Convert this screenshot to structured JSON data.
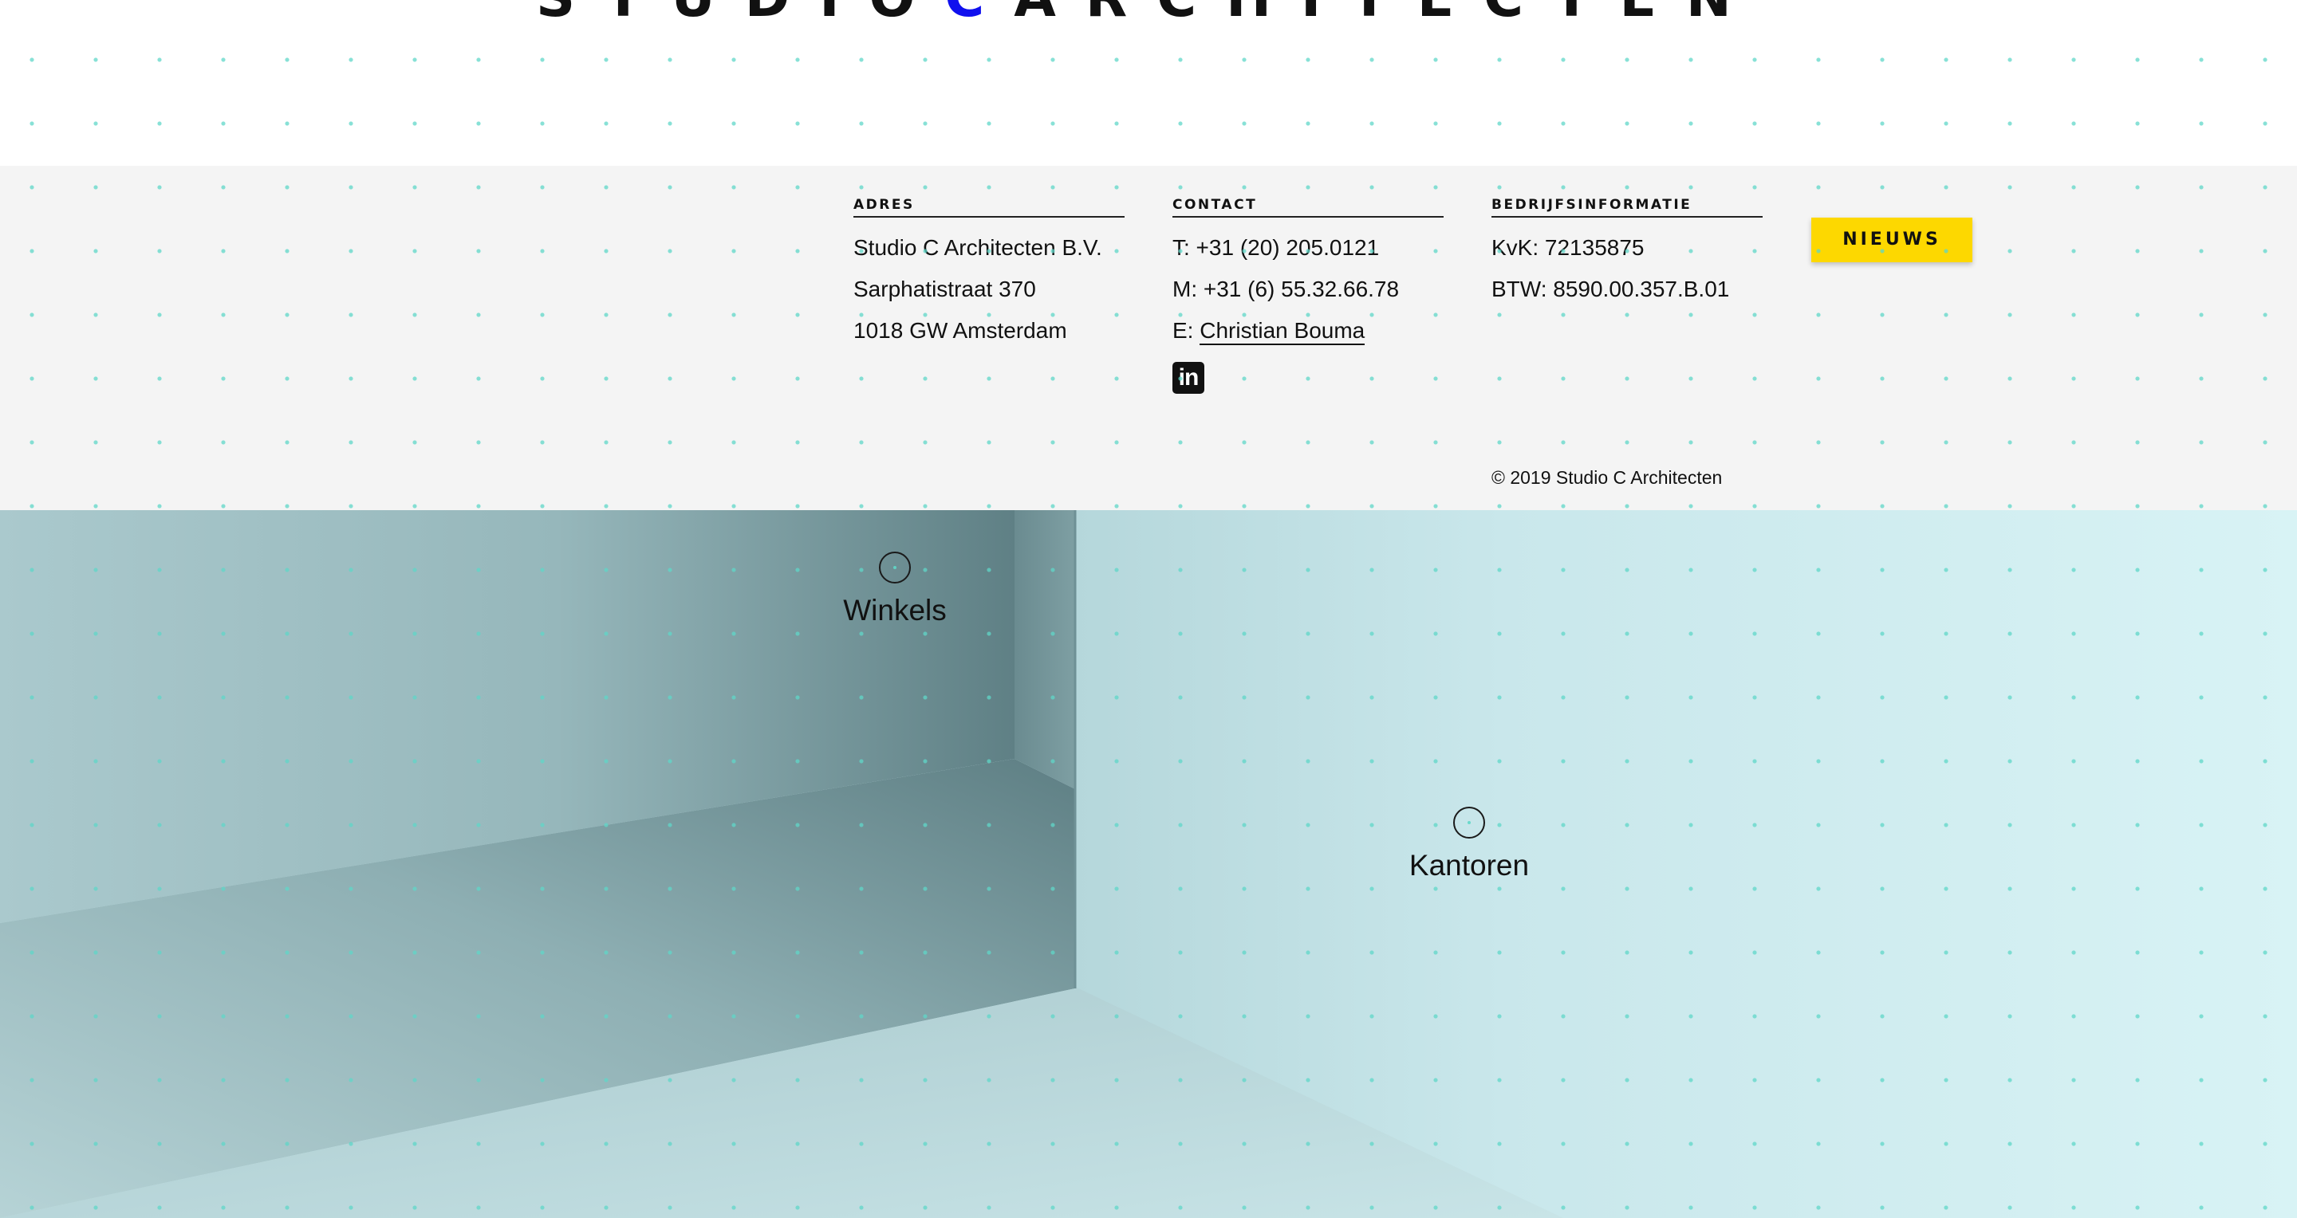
{
  "header": {
    "logo_before": "STUDIO",
    "logo_accent": "C",
    "logo_after": "ARCHITECTEN"
  },
  "footer": {
    "address": {
      "heading": "ADRES",
      "lines": [
        "Studio C Architecten B.V.",
        "Sarphatistraat 370",
        "1018 GW Amsterdam"
      ]
    },
    "contact": {
      "heading": "CONTACT",
      "phone": "T: +31 (20) 205.0121",
      "mobile": "M: +31 (6) 55.32.66.78",
      "email_prefix": "E:",
      "email_link": "Christian Bouma",
      "linkedin_glyph": "in"
    },
    "company": {
      "heading": "BEDRIJFSINFORMATIE",
      "kvk": "KvK: 72135875",
      "btw": "BTW: 8590.00.357.B.01"
    },
    "news_button": "NIEUWS",
    "copyright": "© 2019 Studio C Architecten"
  },
  "hero": {
    "hotspots": [
      {
        "label": "Winkels"
      },
      {
        "label": "Kantoren"
      }
    ]
  },
  "colors": {
    "logo_accent": "#1010ee",
    "news_button": "#fdd800",
    "dot_grid": "#5fd7c8",
    "info_background": "#f4f4f4"
  }
}
